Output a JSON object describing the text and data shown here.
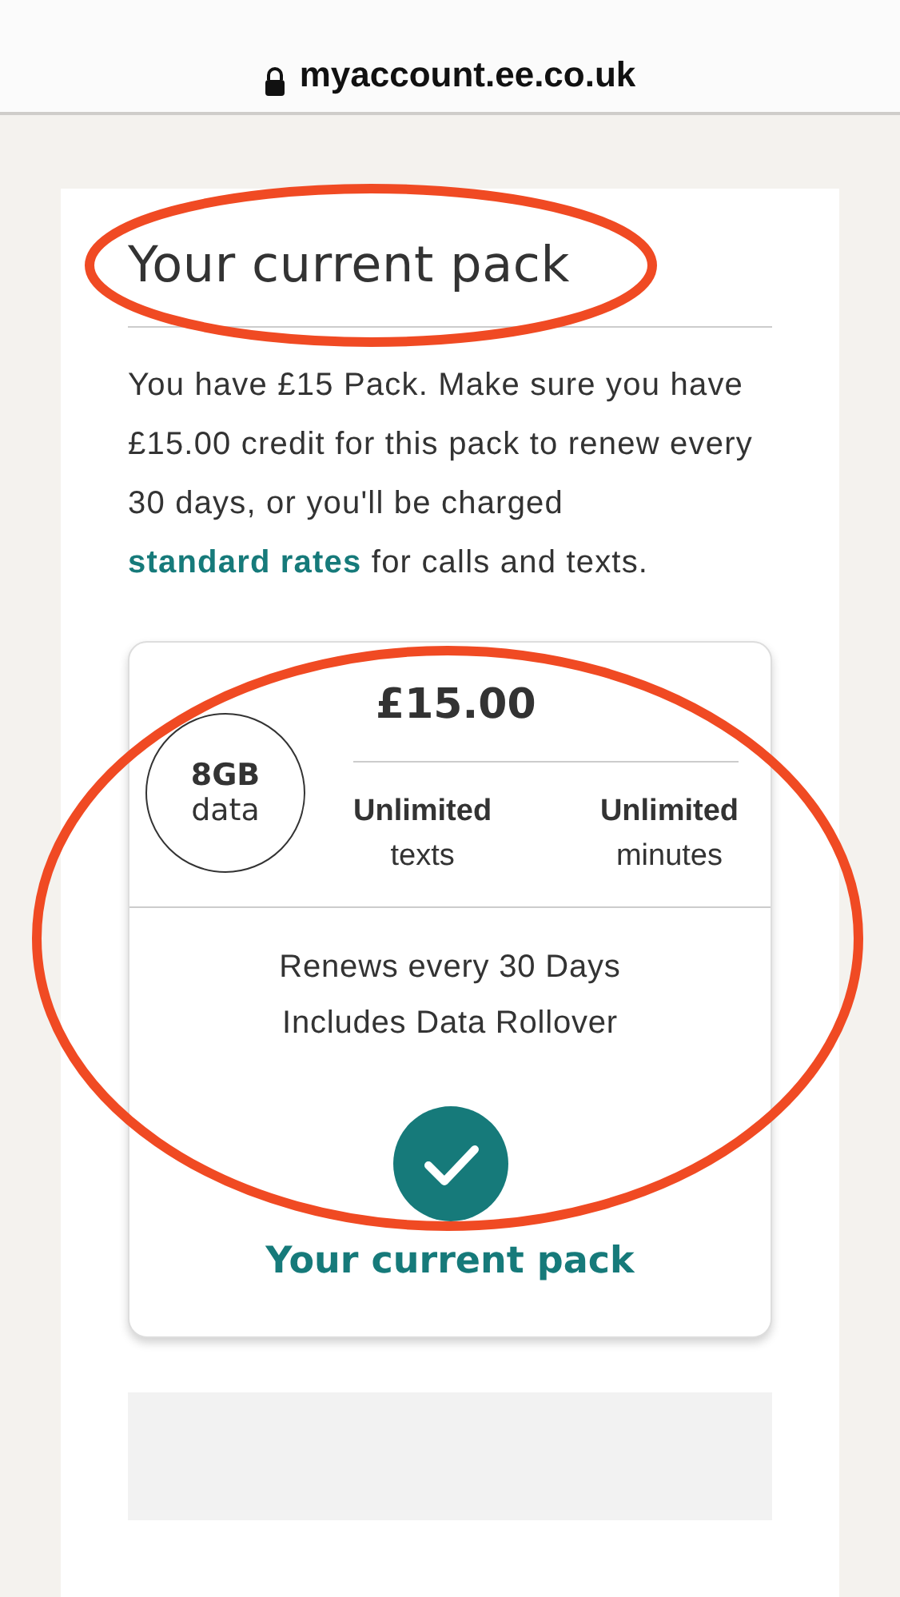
{
  "address_bar": {
    "url": "myaccount.ee.co.uk"
  },
  "section": {
    "title": "Your current pack",
    "intro": {
      "before": "You have £15 Pack. Make sure you have £15.00 credit for this pack to renew every 30 days, or you'll be charged",
      "link": "standard rates",
      "after": "for calls and texts."
    }
  },
  "pack": {
    "data_amount": "8GB",
    "data_unit": "data",
    "price": "£15.00",
    "allowances": [
      {
        "value": "Unlimited",
        "label": "texts"
      },
      {
        "value": "Unlimited",
        "label": "minutes"
      }
    ],
    "notes": [
      "Renews every 30 Days",
      "Includes Data Rollover"
    ],
    "status": "Your current pack"
  }
}
